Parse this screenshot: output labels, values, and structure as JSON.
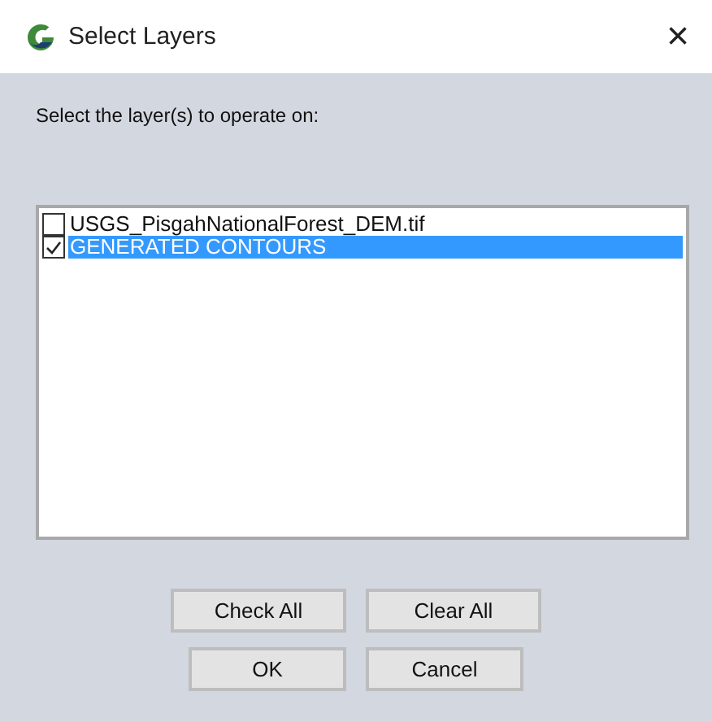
{
  "window": {
    "title": "Select Layers",
    "close": "×"
  },
  "prompt": "Select the layer(s) to operate on:",
  "layers": [
    {
      "name": "USGS_PisgahNationalForest_DEM.tif",
      "checked": false,
      "selected": false
    },
    {
      "name": "GENERATED CONTOURS",
      "checked": true,
      "selected": true
    }
  ],
  "buttons": [
    [
      "Check All",
      "Clear All"
    ],
    [
      "OK",
      "Cancel"
    ]
  ]
}
